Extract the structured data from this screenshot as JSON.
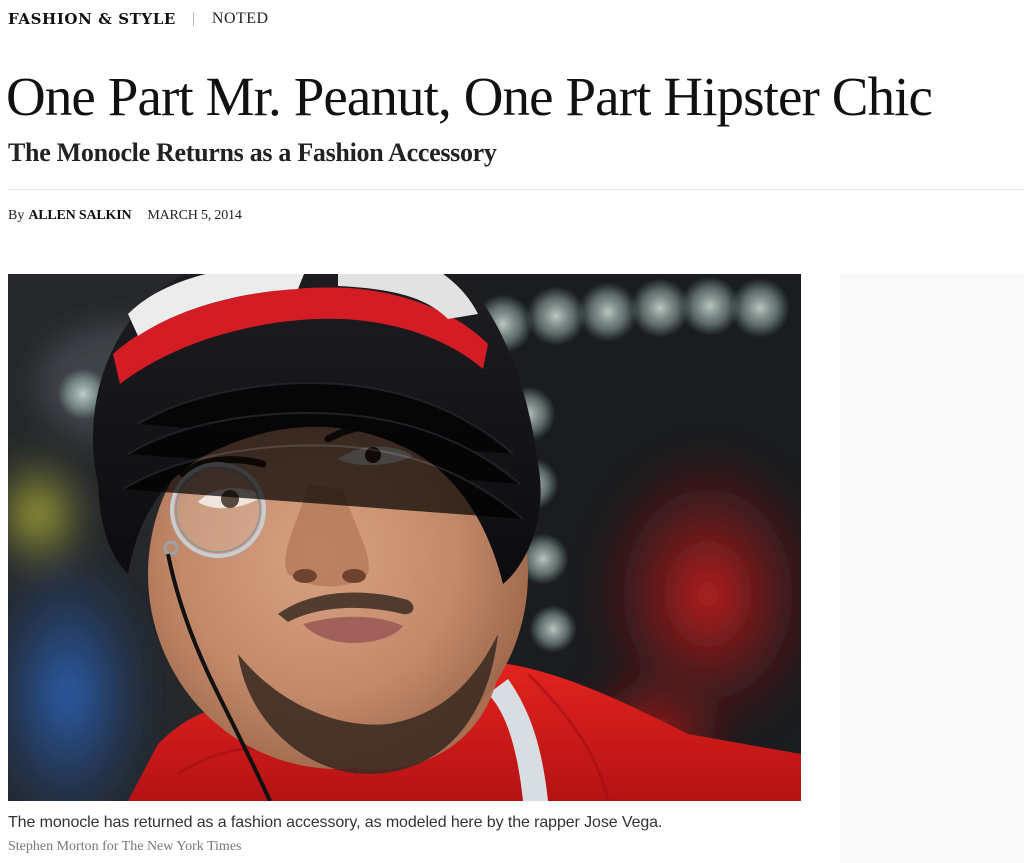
{
  "kicker": {
    "section": "FASHION & STYLE",
    "column": "NOTED"
  },
  "article": {
    "headline": "One Part Mr. Peanut, One Part Hipster Chic",
    "subheadline": "The Monocle Returns as a Fashion Accessory",
    "byline": {
      "prefix": "By",
      "author": "ALLEN SALKIN",
      "date": "MARCH 5, 2014"
    },
    "photo": {
      "caption": "The monocle has returned as a fashion accessory, as modeled here by the rapper Jose Vega.",
      "credit": "Stephen Morton for The New York Times"
    }
  },
  "colors": {
    "beanie_black": "#151518",
    "beanie_red": "#d41c24",
    "sweater_red": "#d4161a",
    "skin": "#c98e6e",
    "text": "#111111",
    "caption_credit": "#777777"
  }
}
